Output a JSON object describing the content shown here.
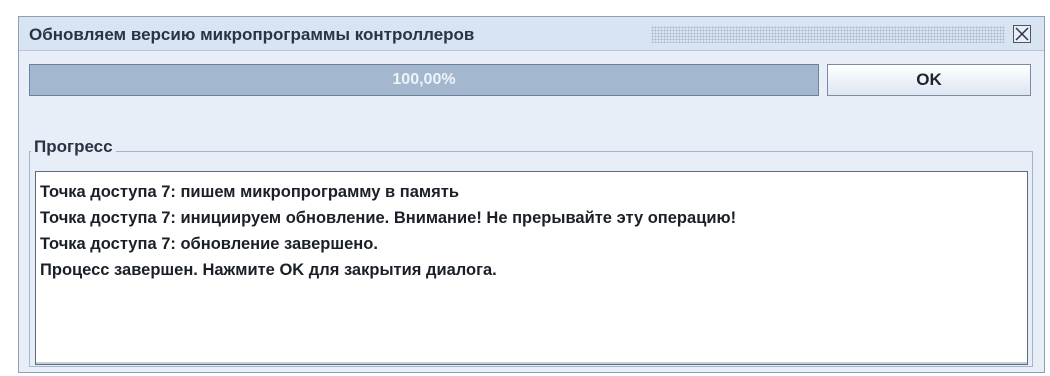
{
  "dialog": {
    "title": "Обновляем версию микропрограммы контроллеров",
    "close_icon": "close-icon"
  },
  "progress": {
    "value_percent": 100,
    "label": "100,00%",
    "fill_color": "#a3b8cf"
  },
  "buttons": {
    "ok_label": "OK"
  },
  "group": {
    "legend": "Прогресс",
    "log_lines": [
      "Точка доступа 7: пишем микропрограмму в память",
      "Точка доступа 7: инициируем обновление. Внимание! Не прерывайте эту операцию!",
      "Точка доступа 7: обновление завершено.",
      "Процесс завершен. Нажмите OK для закрытия диалога."
    ]
  }
}
